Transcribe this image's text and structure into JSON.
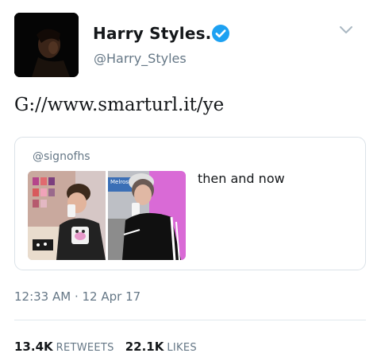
{
  "author": {
    "display_name": "Harry Styles.",
    "handle": "@Harry_Styles",
    "verified_icon": "verified-badge-icon",
    "menu_icon": "chevron-down-icon"
  },
  "tweet": {
    "text": "G://www.smarturl.it/ye",
    "timestamp": "12:33 AM · 12 Apr 17"
  },
  "quote": {
    "handle": "@signofhs",
    "text": "then and now",
    "photo_sign": "Melrose"
  },
  "stats": {
    "retweets_count": "13.4K",
    "retweets_label": "RETWEETS",
    "likes_count": "22.1K",
    "likes_label": "LIKES"
  },
  "colors": {
    "text": "#14171a",
    "secondary": "#657786",
    "verified": "#1da1f2",
    "border": "#dbe2e8"
  }
}
